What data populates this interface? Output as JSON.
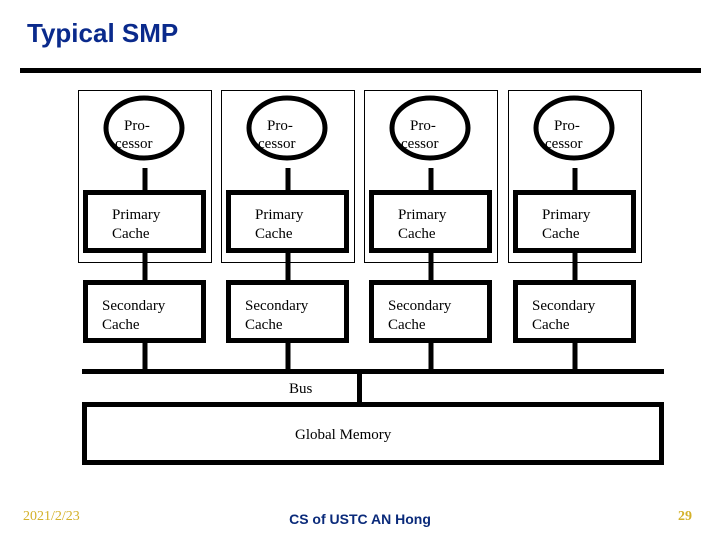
{
  "slide": {
    "title": "Typical SMP",
    "footer": {
      "date": "2021/2/23",
      "center": "CS of USTC AN Hong",
      "page": "29"
    }
  },
  "diagram": {
    "nodes": [
      {
        "processor": [
          "Pro-",
          "cessor"
        ],
        "primary": [
          "Primary",
          "Cache"
        ],
        "secondary": [
          "Secondary",
          "Cache"
        ]
      },
      {
        "processor": [
          "Pro-",
          "cessor"
        ],
        "primary": [
          "Primary",
          "Cache"
        ],
        "secondary": [
          "Secondary",
          "Cache"
        ]
      },
      {
        "processor": [
          "Pro-",
          "cessor"
        ],
        "primary": [
          "Primary",
          "Cache"
        ],
        "secondary": [
          "Secondary",
          "Cache"
        ]
      },
      {
        "processor": [
          "Pro-",
          "cessor"
        ],
        "primary": [
          "Primary",
          "Cache"
        ],
        "secondary": [
          "Secondary",
          "Cache"
        ]
      }
    ],
    "bus_label": "Bus",
    "memory_label": "Global Memory"
  }
}
